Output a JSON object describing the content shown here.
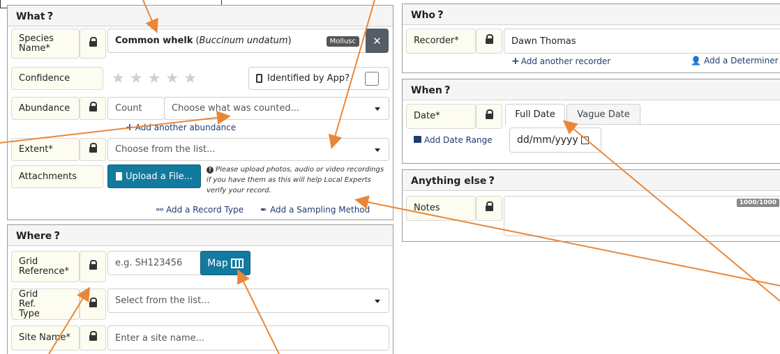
{
  "what": {
    "title": "What",
    "help": "?",
    "species_label": "Species Name*",
    "species_common": "Common whelk",
    "species_latin": "Buccinum undatum",
    "species_badge": "Mollusc",
    "clear_symbol": "✕",
    "confidence_label": "Confidence",
    "confidence_rating": 0,
    "identified_by_app_label": "Identified by App?",
    "abundance_label": "Abundance",
    "abundance_type": "Count",
    "abundance_placeholder": "Choose what was counted...",
    "add_abundance": "Add another abundance",
    "extent_label": "Extent*",
    "extent_placeholder": "Choose from the list...",
    "attachments_label": "Attachments",
    "upload_button": "Upload a File...",
    "upload_note": "Please upload photos, audio or video recordings if you have them as this will help Local Experts verify your record.",
    "add_record_type": "Add a Record Type",
    "add_sampling_method": "Add a Sampling Method"
  },
  "where": {
    "title": "Where",
    "help": "?",
    "grid_ref_label": "Grid Reference*",
    "grid_ref_placeholder": "e.g. SH123456",
    "map_button": "Map",
    "grid_ref_type_label": "Grid Ref. Type",
    "grid_ref_type_placeholder": "Select from the list...",
    "site_name_label": "Site Name*",
    "site_name_placeholder": "Enter a site name..."
  },
  "who": {
    "title": "Who",
    "help": "?",
    "recorder_label": "Recorder*",
    "recorder_value": "Dawn Thomas",
    "add_recorder": "Add another recorder",
    "add_determiner": "Add a Determiner"
  },
  "when": {
    "title": "When",
    "help": "?",
    "date_label": "Date*",
    "tab_full": "Full Date",
    "tab_vague": "Vague Date",
    "date_placeholder": "dd/mm/yyyy",
    "add_date_range": "Add Date Range"
  },
  "anything_else": {
    "title": "Anything else",
    "help": "?",
    "notes_label": "Notes",
    "char_counter": "1000/1000"
  },
  "colors": {
    "arrow": "#e8873a",
    "button_teal": "#127a9e",
    "label_bg": "#fdfcf0",
    "link": "#1f3d6e"
  }
}
